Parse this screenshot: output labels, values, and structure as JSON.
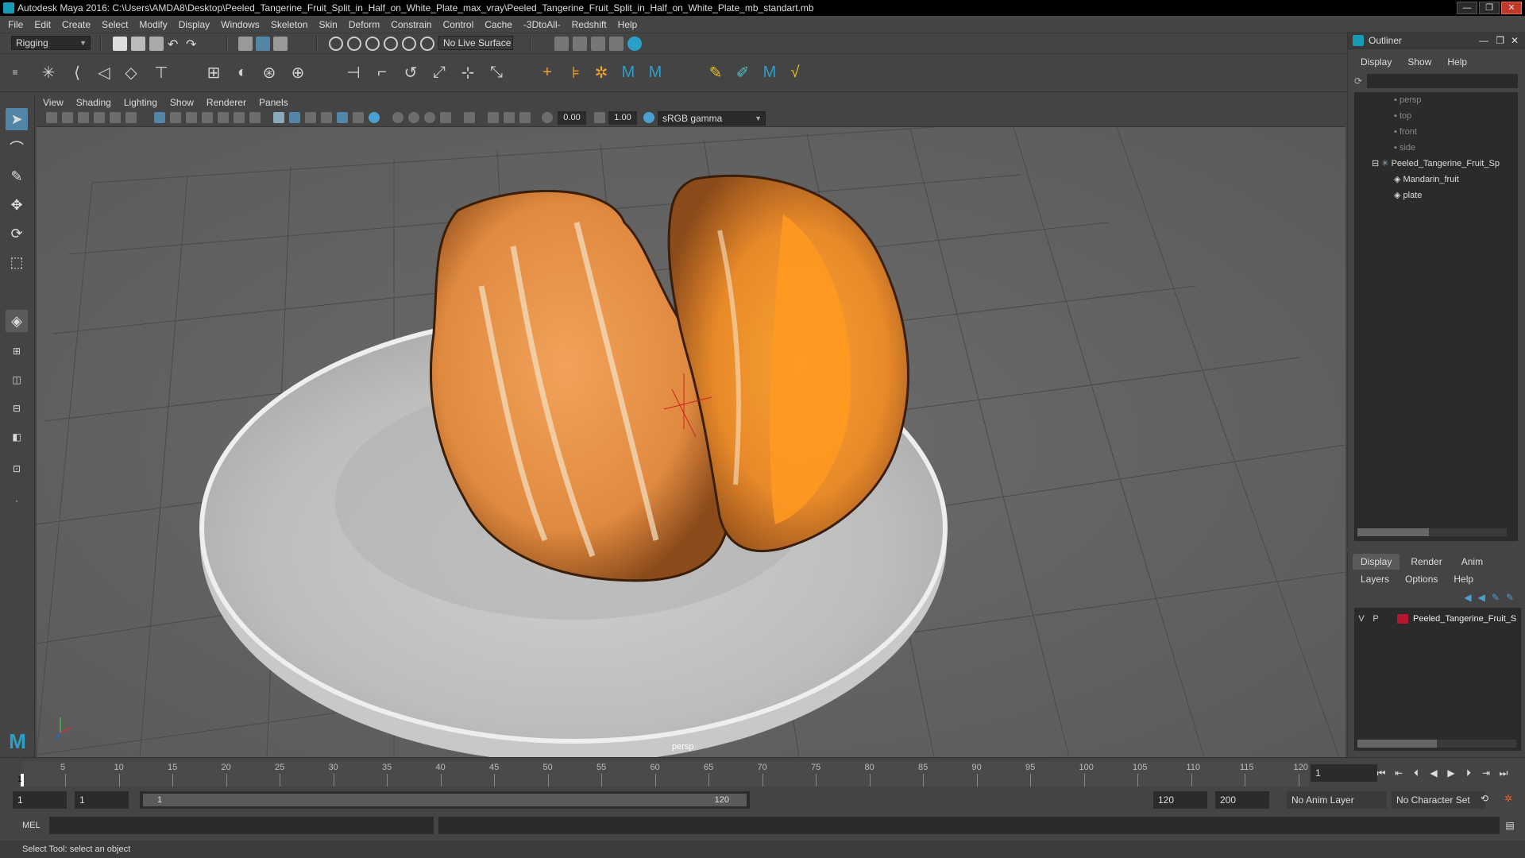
{
  "window": {
    "title": "Autodesk Maya 2016: C:\\Users\\AMDA8\\Desktop\\Peeled_Tangerine_Fruit_Split_in_Half_on_White_Plate_max_vray\\Peeled_Tangerine_Fruit_Split_in_Half_on_White_Plate_mb_standart.mb",
    "buttons": [
      "—",
      "❐",
      "✕"
    ]
  },
  "menubar": [
    "File",
    "Edit",
    "Create",
    "Select",
    "Modify",
    "Display",
    "Windows",
    "Skeleton",
    "Skin",
    "Deform",
    "Constrain",
    "Control",
    "Cache",
    "-3DtoAll-",
    "Redshift",
    "Help"
  ],
  "statusline": {
    "menuset": "Rigging",
    "live_surface": "No Live Surface"
  },
  "panel": {
    "menus": [
      "View",
      "Shading",
      "Lighting",
      "Show",
      "Renderer",
      "Panels"
    ],
    "near_value": "0.00",
    "far_value": "1.00",
    "color_space": "sRGB gamma",
    "camera_label": "persp"
  },
  "outliner": {
    "title": "Outliner",
    "menus": [
      "Display",
      "Show",
      "Help"
    ],
    "items": [
      {
        "label": "persp",
        "type": "camera"
      },
      {
        "label": "top",
        "type": "camera"
      },
      {
        "label": "front",
        "type": "camera"
      },
      {
        "label": "side",
        "type": "camera"
      },
      {
        "label": "Peeled_Tangerine_Fruit_Sp",
        "type": "group"
      },
      {
        "label": "Mandarin_fruit",
        "type": "mesh"
      },
      {
        "label": "plate",
        "type": "mesh"
      }
    ]
  },
  "layer_editor": {
    "tabs": [
      "Display",
      "Render",
      "Anim"
    ],
    "menus": [
      "Layers",
      "Options",
      "Help"
    ],
    "layer": {
      "v": "V",
      "p": "P",
      "name": "Peeled_Tangerine_Fruit_S",
      "color": "#b5172e"
    }
  },
  "timeline": {
    "ticks": [
      "5",
      "10",
      "15",
      "20",
      "25",
      "30",
      "35",
      "40",
      "45",
      "50",
      "55",
      "60",
      "65",
      "70",
      "75",
      "80",
      "85",
      "90",
      "95",
      "100",
      "105",
      "110",
      "115",
      "120"
    ],
    "start_marker": "1",
    "current_frame": "1"
  },
  "range": {
    "start": "1",
    "anim_start": "1",
    "slider_start": "1",
    "slider_end": "120",
    "anim_end": "120",
    "end": "200",
    "anim_layer": "No Anim Layer",
    "character_set": "No Character Set"
  },
  "cmdline": {
    "label": "MEL"
  },
  "helpline": "Select Tool: select an object",
  "colors": {
    "accent": "#5285a6",
    "maya_teal": "#1a9bb5",
    "layer_red": "#b5172e"
  }
}
